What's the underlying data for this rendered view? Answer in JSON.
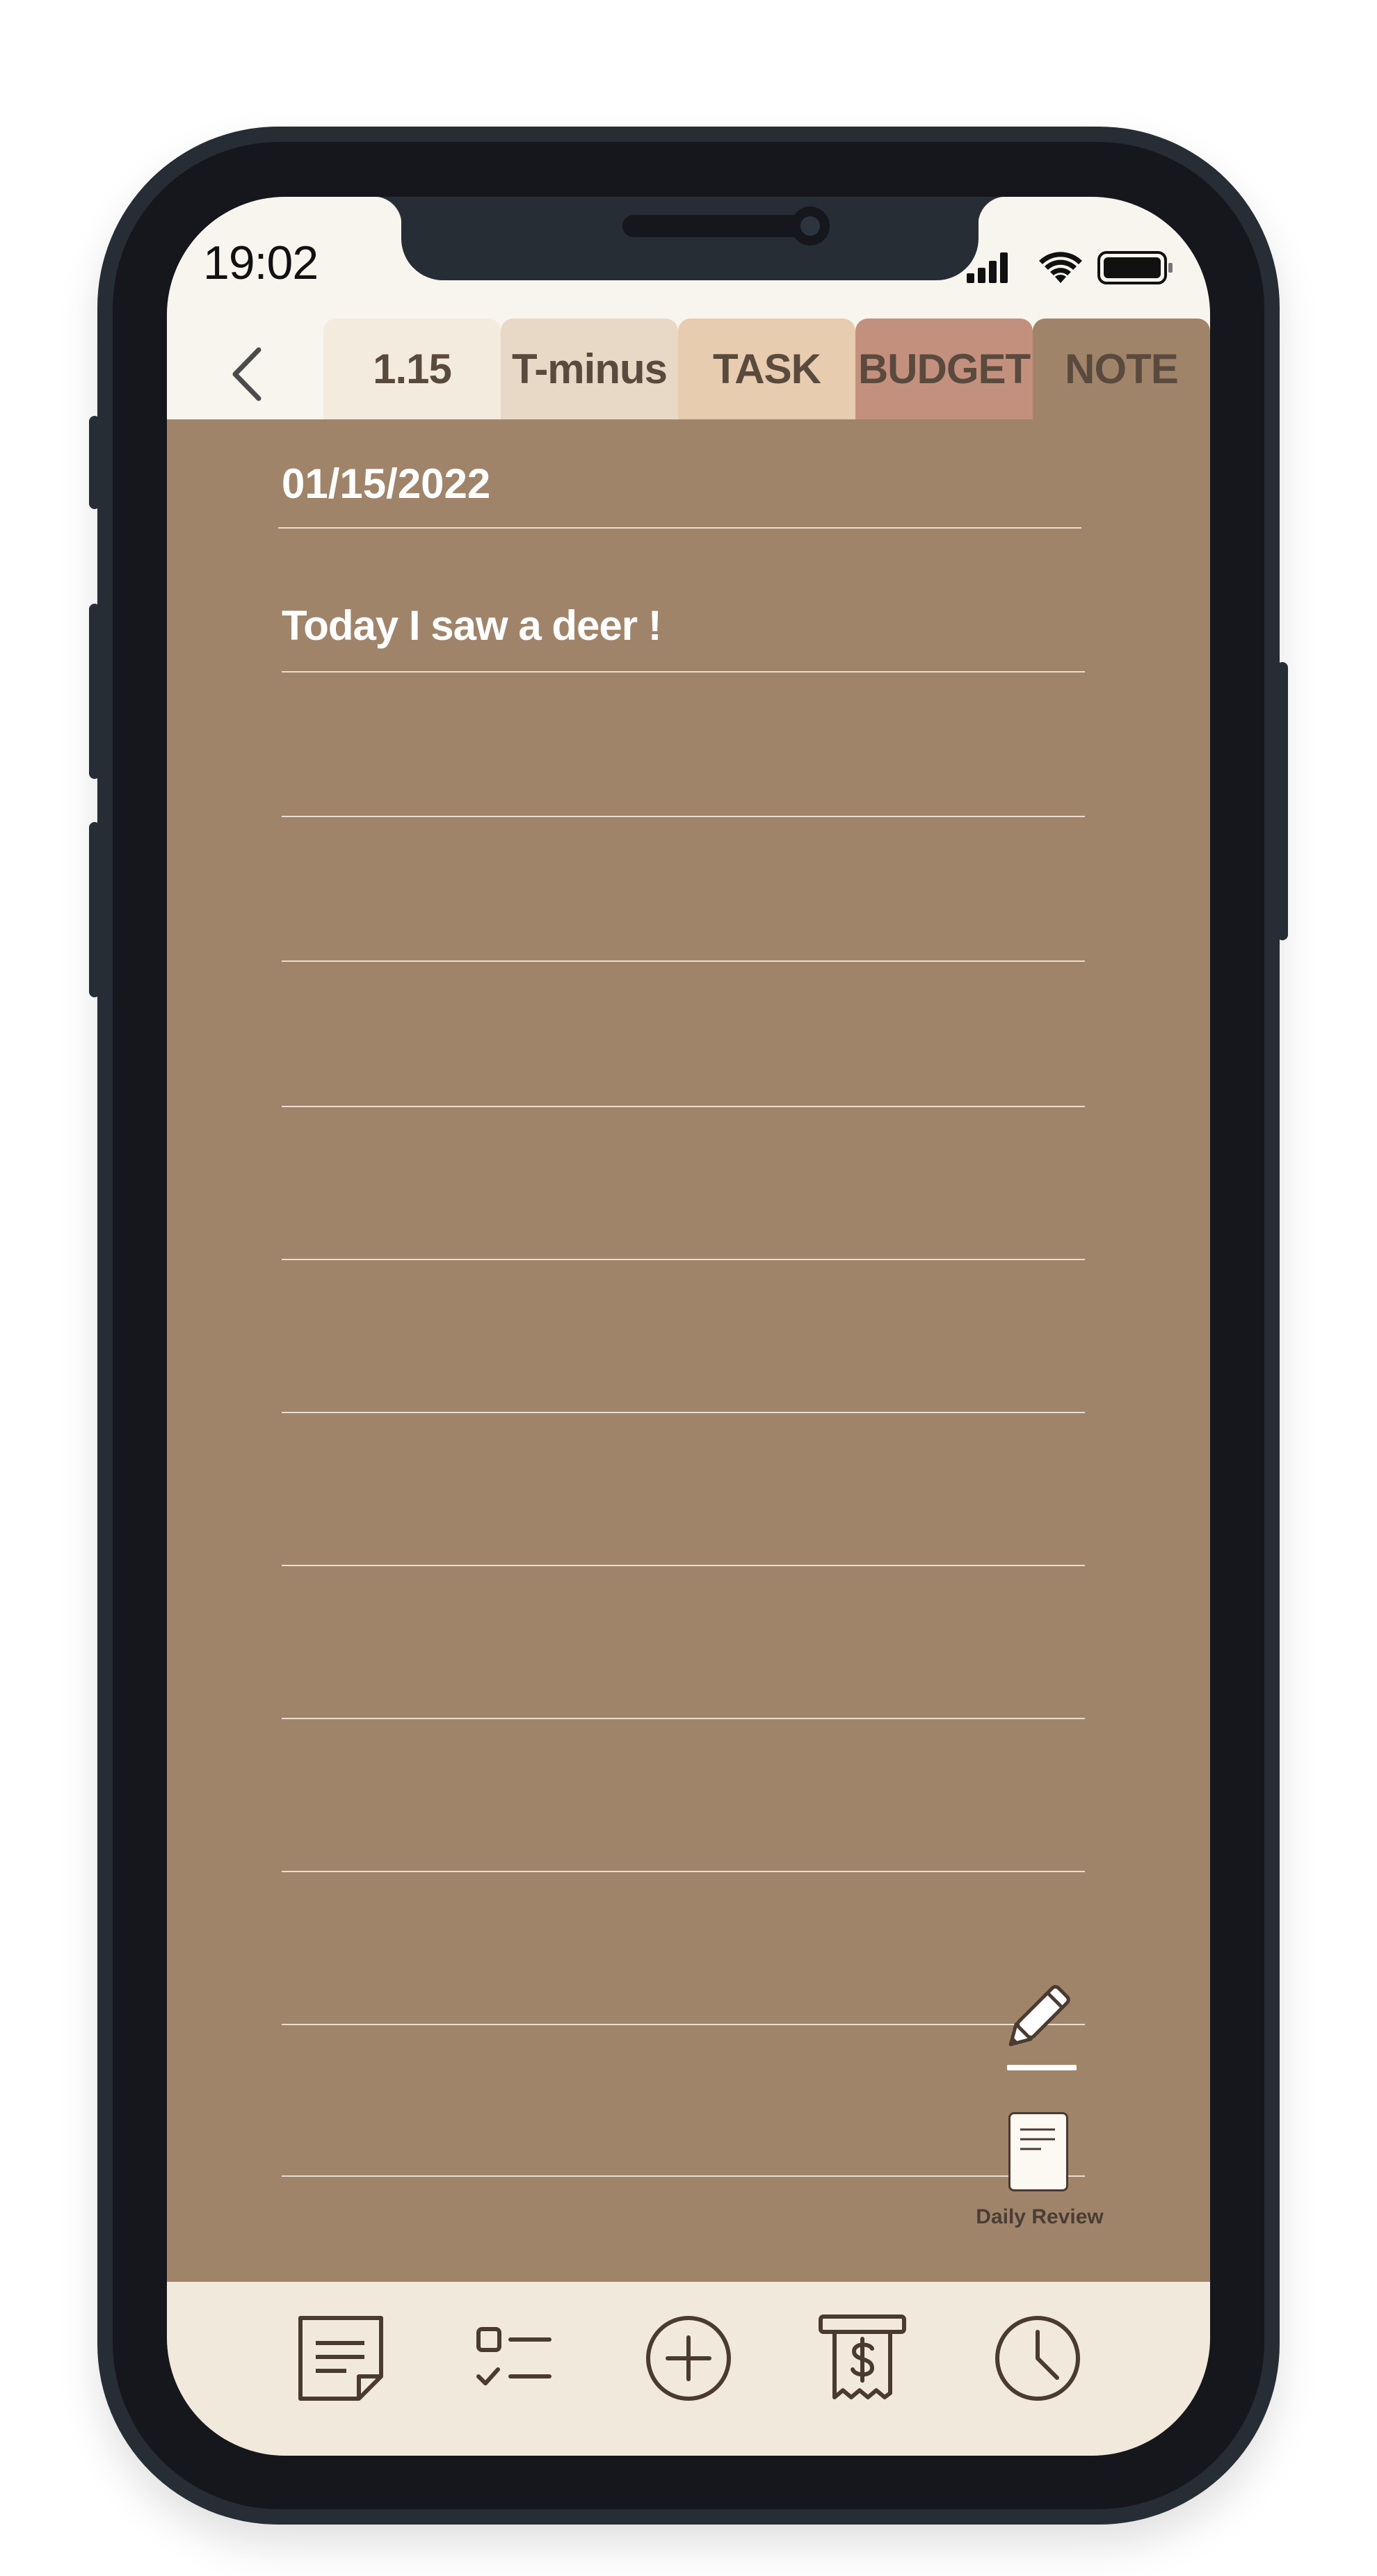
{
  "status_bar": {
    "time": "19:02"
  },
  "tabs": [
    {
      "label": "1.15",
      "color": "#f3ebde"
    },
    {
      "label": "T-minus",
      "color": "#e7d9c6"
    },
    {
      "label": "TASK",
      "color": "#e7ccaf"
    },
    {
      "label": "BUDGET",
      "color": "#c4907e"
    },
    {
      "label": "NOTE",
      "color": "#a0846a"
    }
  ],
  "note": {
    "date": "01/15/2022",
    "text": "Today I saw a deer !",
    "background_color": "#a0846a"
  },
  "floating": {
    "edit_icon": "pencil-icon",
    "daily_review_label": "Daily Review"
  },
  "bottom_nav": {
    "background_color": "#f1e9dc",
    "items": [
      "note-icon",
      "checklist-icon",
      "add-icon",
      "receipt-icon",
      "clock-icon"
    ]
  }
}
